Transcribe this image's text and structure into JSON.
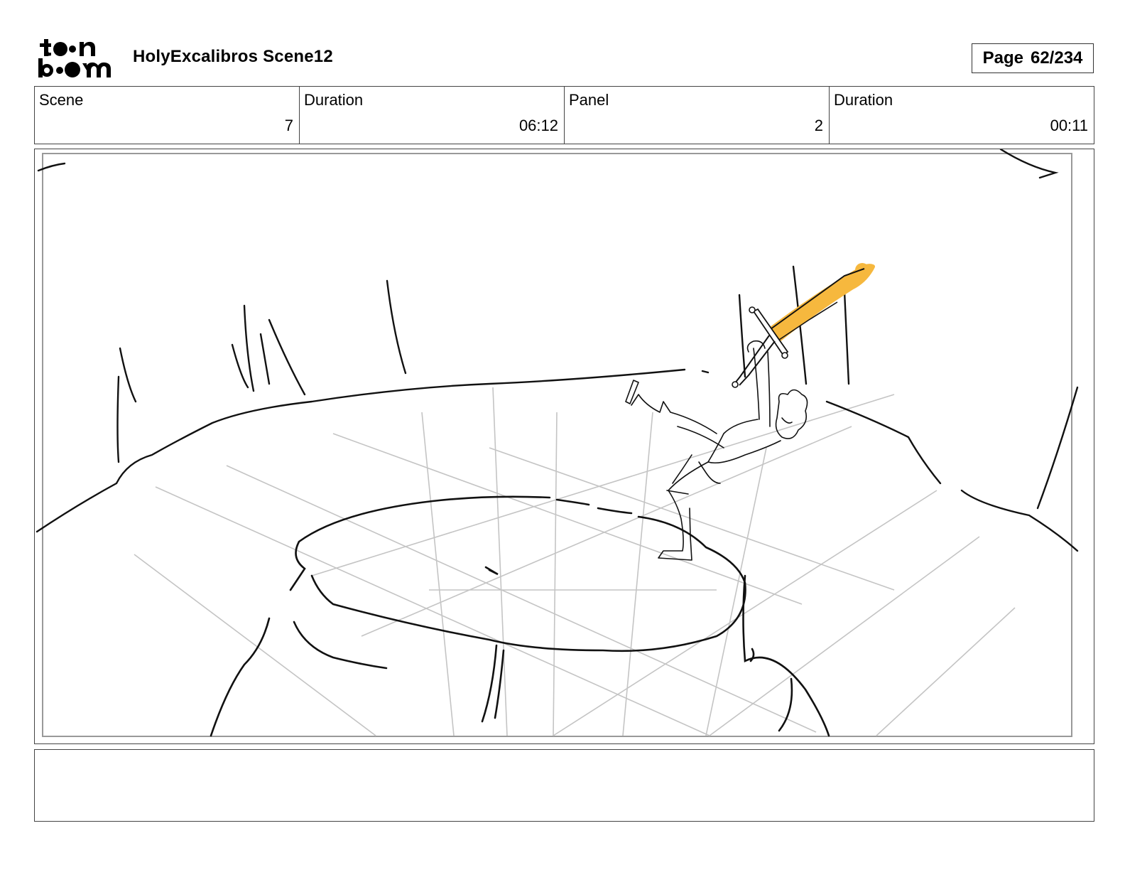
{
  "header": {
    "logo_text_top": "toon",
    "logo_text_bottom": "boom",
    "title": "HolyExcalibros Scene12",
    "page_label": "Page",
    "page_value": "62/234"
  },
  "info": {
    "scene_label": "Scene",
    "scene_value": "7",
    "scene_duration_label": "Duration",
    "scene_duration_value": "06:12",
    "panel_label": "Panel",
    "panel_value": "2",
    "panel_duration_label": "Duration",
    "panel_duration_value": "00:11"
  },
  "colors": {
    "sword": "#f6b83e",
    "construction_lines": "#c4c4c4",
    "ink": "#111111"
  },
  "notes": {
    "text": ""
  }
}
